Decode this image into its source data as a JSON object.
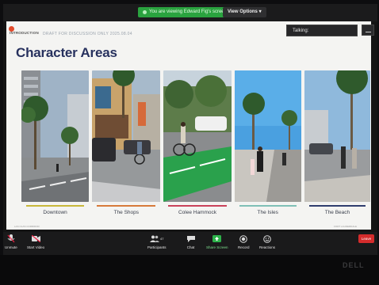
{
  "banner": {
    "text": "You are viewing Edward Fig's screen"
  },
  "view_options": {
    "label": "View Options"
  },
  "talking": {
    "label": "Talking:"
  },
  "slide": {
    "section": "INTRODUCTION",
    "draft": "DRAFT FOR DISCUSSION ONLY 2025.08.04",
    "title": "Character Areas",
    "areas": [
      {
        "label": "Downtown",
        "color": "#c8b73a"
      },
      {
        "label": "The Shops",
        "color": "#d77a3a"
      },
      {
        "label": "Colee Hammock",
        "color": "#c9415a"
      },
      {
        "label": "The Isles",
        "color": "#7fc0b6"
      },
      {
        "label": "The Beach",
        "color": "#2f3d6e"
      }
    ],
    "footer_left": "LAS OLAS CORRIDOR",
    "footer_right": "FORT LAUDERDALE"
  },
  "controls": {
    "unmute": "Unmute",
    "start_video": "Start Video",
    "participants": "Participants",
    "participant_count": "47",
    "chat": "Chat",
    "share_screen": "Share Screen",
    "record": "Record",
    "reactions": "Reactions",
    "leave": "Leave"
  },
  "monitor_brand": "DELL",
  "icons": [
    "microphone-muted-icon",
    "video-off-icon",
    "participants-icon",
    "chat-icon",
    "share-screen-icon",
    "record-icon",
    "reactions-icon",
    "shield-icon",
    "minimize-icon"
  ]
}
